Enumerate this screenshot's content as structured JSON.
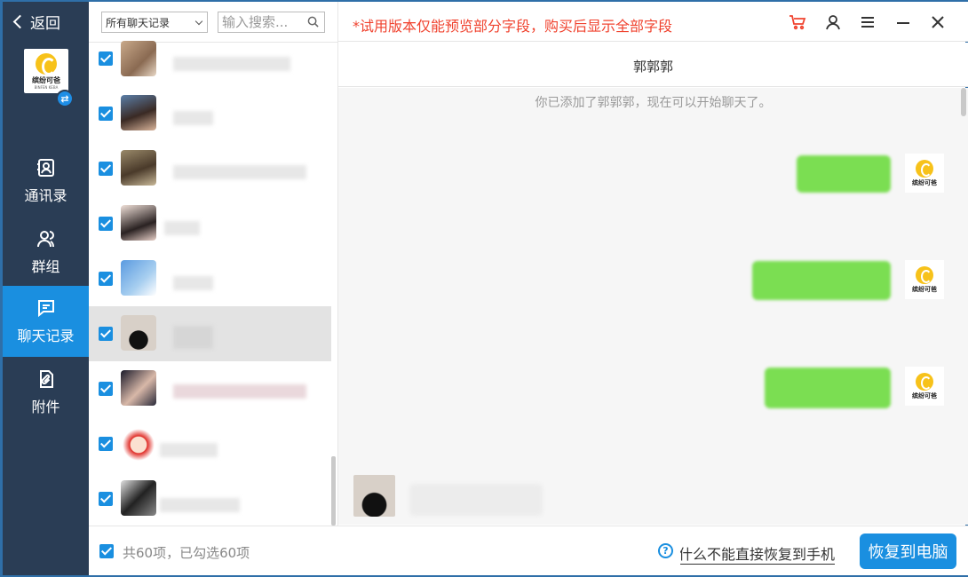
{
  "nav": {
    "back_label": "返回",
    "logo_text": "缤纷可爸",
    "logo_sub": "BINFEN KEBA",
    "switch_glyph": "⇄",
    "items": [
      {
        "label": "通讯录",
        "icon": "contacts-icon"
      },
      {
        "label": "群组",
        "icon": "group-icon"
      },
      {
        "label": "聊天记录",
        "icon": "chat-icon"
      },
      {
        "label": "附件",
        "icon": "attachment-icon"
      }
    ],
    "active_index": 2
  },
  "list": {
    "filter_value": "所有聊天记录",
    "search_placeholder": "输入搜索...",
    "rows": [
      {
        "checked": true,
        "selected": false
      },
      {
        "checked": true,
        "selected": false
      },
      {
        "checked": true,
        "selected": false
      },
      {
        "checked": true,
        "selected": false
      },
      {
        "checked": true,
        "selected": false
      },
      {
        "checked": true,
        "selected": true
      },
      {
        "checked": true,
        "selected": false
      },
      {
        "checked": true,
        "selected": false
      },
      {
        "checked": true,
        "selected": false
      }
    ]
  },
  "topbar": {
    "notice": "*试用版本仅能预览部分字段，购买后显示全部字段",
    "icons": [
      "cart-icon",
      "user-icon",
      "menu-icon",
      "minimize-icon",
      "close-icon"
    ]
  },
  "chat": {
    "title": "郭郭郭",
    "system_message": "你已添加了郭郭郭，现在可以开始聊天了。"
  },
  "footer": {
    "count_text": "共60项，已勾选60项",
    "help_text": "为什么不能直接恢复到手机",
    "restore_label": "恢复到电脑"
  },
  "colors": {
    "nav_bg": "#2a3d55",
    "accent": "#1a8fe0",
    "notice_red": "#f0432f",
    "bubble_green": "#7bde52"
  }
}
